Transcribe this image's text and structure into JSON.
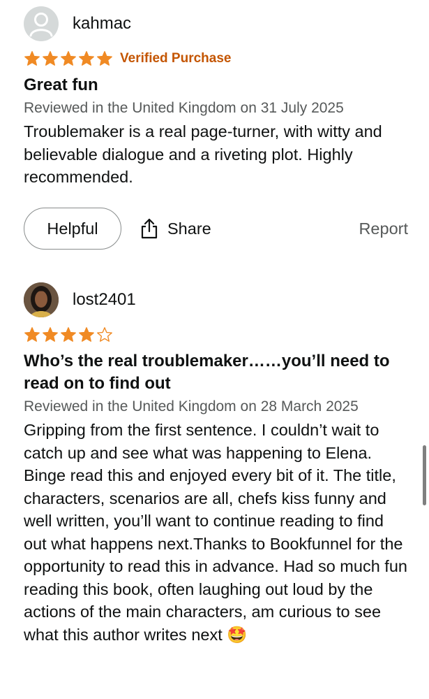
{
  "reviews": [
    {
      "username": "kahmac",
      "avatar_icon": "default-user-icon",
      "rating": 5,
      "max_rating": 5,
      "verified_label": "Verified Purchase",
      "title": "Great fun",
      "meta": "Reviewed in the United Kingdom on 31 July 2025",
      "body": "Troublemaker is a real page-turner, with witty and believable dialogue and a riveting plot. Highly recommended.",
      "actions": {
        "helpful_label": "Helpful",
        "share_label": "Share",
        "report_label": "Report"
      }
    },
    {
      "username": "lost2401",
      "avatar_icon": "profile-photo",
      "rating": 4,
      "max_rating": 5,
      "title": "Who’s the real troublemaker……you’ll need to read on to find out",
      "meta": "Reviewed in the United Kingdom on 28 March 2025",
      "body": "Gripping from the first sentence. I couldn’t wait to catch up and see what was happening to Elena. Binge read this and enjoyed every bit of it. The title, characters, scenarios are all, chefs kiss funny and well written, you’ll want to continue reading to find out what happens next.Thanks to Bookfunnel for the opportunity to read this in advance. Had so much fun reading this book, often laughing out loud by the actions of the main characters, am curious to see what this author writes next 🤩"
    }
  ],
  "colors": {
    "star": "#f08a24",
    "verified": "#c45500",
    "meta": "#565959",
    "text": "#0f1111"
  }
}
